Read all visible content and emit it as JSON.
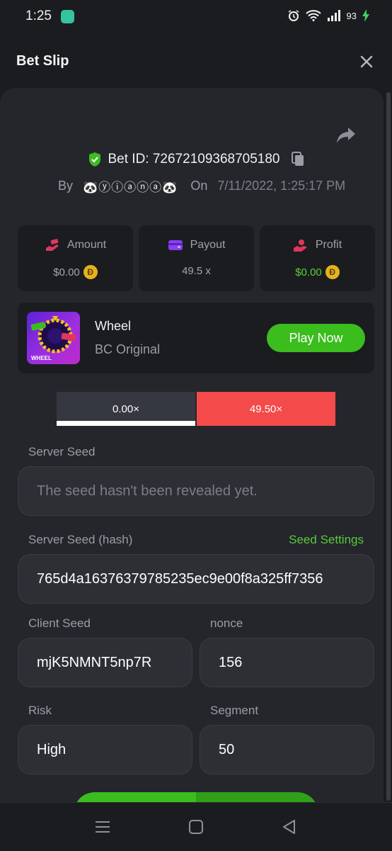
{
  "status_bar": {
    "time": "1:25",
    "battery": "93"
  },
  "header": {
    "title": "Bet Slip"
  },
  "bet": {
    "id_label": "Bet ID: 72672109368705180",
    "by_label": "By",
    "user": "🐼ⓨⓘⓐⓝⓐ🐼",
    "on_label": "On",
    "date": "7/11/2022, 1:25:17 PM"
  },
  "stats": {
    "amount": {
      "label": "Amount",
      "value": "$0.00",
      "coin": "Ð"
    },
    "payout": {
      "label": "Payout",
      "value": "49.5 x"
    },
    "profit": {
      "label": "Profit",
      "value": "$0.00",
      "coin": "Ð"
    }
  },
  "game": {
    "name": "Wheel",
    "subtitle": "BC Original",
    "play_label": "Play Now",
    "thumb_label": "WHEEL"
  },
  "multiplier": {
    "left": "0.00×",
    "right": "49.50×"
  },
  "server_seed": {
    "label": "Server Seed",
    "placeholder": "The seed hasn't been revealed yet."
  },
  "server_seed_hash": {
    "label": "Server Seed (hash)",
    "link": "Seed Settings",
    "value": "765d4a16376379785235ec9e00f8a325ff7356"
  },
  "client_seed": {
    "label": "Client Seed",
    "value": "mjK5NMNT5np7R"
  },
  "nonce": {
    "label": "nonce",
    "value": "156"
  },
  "risk": {
    "label": "Risk",
    "value": "High"
  },
  "segment": {
    "label": "Segment",
    "value": "50"
  },
  "colors": {
    "accent_green": "#3bbd1e",
    "red": "#f44a4a",
    "panel": "#24262b"
  }
}
